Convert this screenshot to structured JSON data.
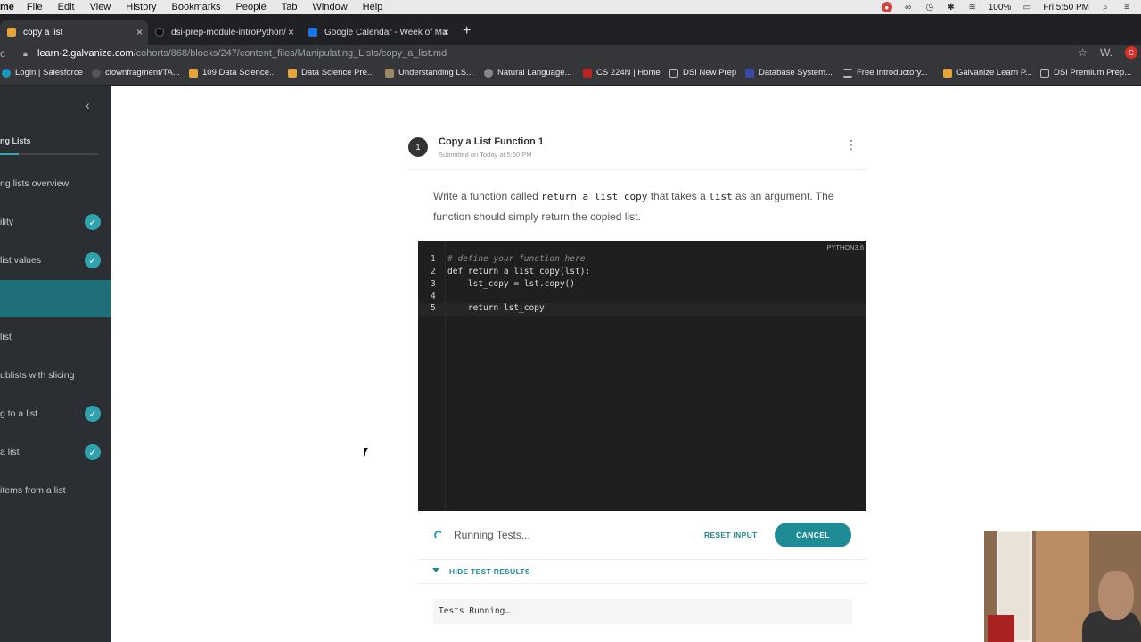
{
  "menubar": {
    "items": [
      "me",
      "File",
      "Edit",
      "View",
      "History",
      "Bookmarks",
      "People",
      "Tab",
      "Window",
      "Help"
    ],
    "battery": "100%",
    "clock": "Fri 5:50 PM"
  },
  "tabs": [
    {
      "title": "copy a list",
      "active": true
    },
    {
      "title": "dsi-prep-module-introPython/",
      "active": false
    },
    {
      "title": "Google Calendar - Week of Ma",
      "active": false
    }
  ],
  "address": {
    "host": "learn-2.galvanize.com",
    "path": "/cohorts/868/blocks/247/content_files/Manipulating_Lists/copy_a_list.md",
    "extension_label": "W."
  },
  "bookmarks": [
    "Login | Salesforce",
    "clownfragment/TA...",
    "109 Data Science...",
    "Data Science Pre...",
    "Understanding LS...",
    "Natural Language...",
    "CS 224N | Home",
    "DSI New Prep",
    "Database System...",
    "Free Introductory...",
    "Galvanize Learn P...",
    "DSI Premium Prep..."
  ],
  "sidebar": {
    "section_title": "ng Lists",
    "progress": 0.19,
    "items": [
      {
        "label": "ng lists overview",
        "done": false,
        "selected": false
      },
      {
        "label": "ility",
        "done": true,
        "selected": false
      },
      {
        "label": "list values",
        "done": true,
        "selected": false
      },
      {
        "label": "",
        "done": false,
        "selected": true
      },
      {
        "label": "list",
        "done": false,
        "selected": false
      },
      {
        "label": "ublists with slicing",
        "done": false,
        "selected": false
      },
      {
        "label": "g to a list",
        "done": true,
        "selected": false
      },
      {
        "label": "a list",
        "done": true,
        "selected": false
      },
      {
        "label": "items from a list",
        "done": false,
        "selected": false
      }
    ]
  },
  "card": {
    "number": "1",
    "title": "Copy a List Function 1",
    "subtitle": "Submitted on Today at 5:50 PM",
    "desc_part1": "Write a function called ",
    "desc_code1": "return_a_list_copy",
    "desc_part2": " that takes a ",
    "desc_code2": "list",
    "desc_part3": " as an argument. The function should simply return the copied list."
  },
  "editor": {
    "language": "PYTHON3.6",
    "lines": [
      "# define your function here",
      "def return_a_list_copy(lst):",
      "    lst_copy = lst.copy()",
      "",
      "    return lst_copy"
    ],
    "active_line": 5
  },
  "actions": {
    "status": "Running Tests...",
    "reset_label": "RESET INPUT",
    "cancel_label": "CANCEL",
    "hide_label": "HIDE TEST RESULTS",
    "tests_output": "Tests Running…"
  },
  "colors": {
    "accent": "#1f8b95",
    "sidebar_bg": "#2b2f33",
    "editor_bg": "#1f1f1f"
  }
}
